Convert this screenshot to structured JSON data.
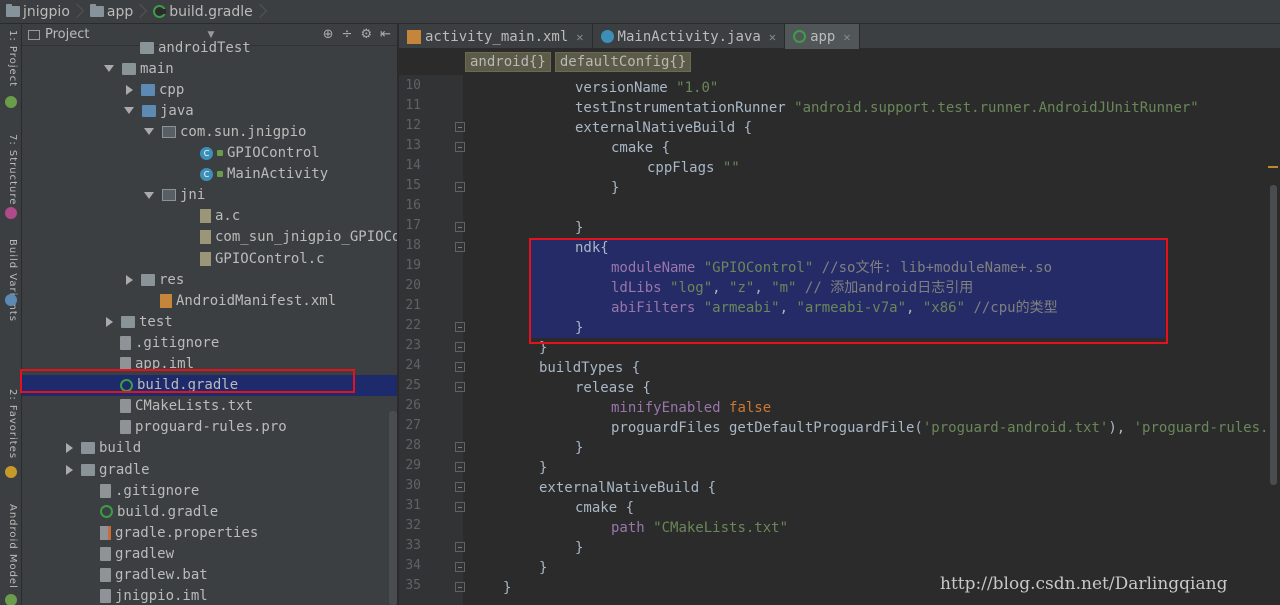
{
  "breadcrumb": [
    {
      "label": "jnigpio",
      "icon": "folder-icon"
    },
    {
      "label": "app",
      "icon": "folder-icon"
    },
    {
      "label": "build.gradle",
      "icon": "gradle-icon"
    }
  ],
  "left_strip": {
    "labels": [
      "1: Project",
      "7: Structure",
      "Build Variants",
      "2: Favorites",
      "Android Model"
    ]
  },
  "project_panel": {
    "title": "Project",
    "tools": [
      "⊕",
      "÷",
      "⚙",
      "⇤"
    ],
    "rows": [
      {
        "label": "androidTest",
        "indent": 4,
        "arrow": "none",
        "icon": "folder"
      },
      {
        "label": "main",
        "indent": 3,
        "arrow": "down",
        "icon": "folder"
      },
      {
        "label": "cpp",
        "indent": 4,
        "arrow": "right",
        "icon": "folder-blue"
      },
      {
        "label": "java",
        "indent": 4,
        "arrow": "down",
        "icon": "folder-blue"
      },
      {
        "label": "com.sun.jnigpio",
        "indent": 5,
        "arrow": "down",
        "icon": "pkg"
      },
      {
        "label": "GPIOControl",
        "indent": 7,
        "arrow": "none",
        "icon": "cls",
        "lock": true
      },
      {
        "label": "MainActivity",
        "indent": 7,
        "arrow": "none",
        "icon": "cls",
        "lock": true
      },
      {
        "label": "jni",
        "indent": 5,
        "arrow": "down",
        "icon": "pkg"
      },
      {
        "label": "a.c",
        "indent": 7,
        "arrow": "none",
        "icon": "cfile"
      },
      {
        "label": "com_sun_jnigpio_GPIOControl",
        "indent": 7,
        "arrow": "none",
        "icon": "cfile"
      },
      {
        "label": "GPIOControl.c",
        "indent": 7,
        "arrow": "none",
        "icon": "cfile"
      },
      {
        "label": "res",
        "indent": 4,
        "arrow": "right",
        "icon": "folder-res"
      },
      {
        "label": "AndroidManifest.xml",
        "indent": 5,
        "arrow": "none",
        "icon": "xml"
      },
      {
        "label": "test",
        "indent": 3,
        "arrow": "right",
        "icon": "folder"
      },
      {
        "label": ".gitignore",
        "indent": 3,
        "arrow": "none",
        "icon": "file"
      },
      {
        "label": "app.iml",
        "indent": 3,
        "arrow": "none",
        "icon": "file"
      },
      {
        "label": "build.gradle",
        "indent": 3,
        "arrow": "none",
        "icon": "gradle",
        "selected": true
      },
      {
        "label": "CMakeLists.txt",
        "indent": 3,
        "arrow": "none",
        "icon": "file"
      },
      {
        "label": "proguard-rules.pro",
        "indent": 3,
        "arrow": "none",
        "icon": "file"
      },
      {
        "label": "build",
        "indent": 1,
        "arrow": "right",
        "icon": "folder"
      },
      {
        "label": "gradle",
        "indent": 1,
        "arrow": "right",
        "icon": "folder"
      },
      {
        "label": ".gitignore",
        "indent": 2,
        "arrow": "none",
        "icon": "file"
      },
      {
        "label": "build.gradle",
        "indent": 2,
        "arrow": "none",
        "icon": "gradle"
      },
      {
        "label": "gradle.properties",
        "indent": 2,
        "arrow": "none",
        "icon": "props"
      },
      {
        "label": "gradlew",
        "indent": 2,
        "arrow": "none",
        "icon": "file"
      },
      {
        "label": "gradlew.bat",
        "indent": 2,
        "arrow": "none",
        "icon": "file"
      },
      {
        "label": "jnigpio.iml",
        "indent": 2,
        "arrow": "none",
        "icon": "file"
      }
    ]
  },
  "editor": {
    "tabs": [
      {
        "label": "activity_main.xml",
        "icon": "xml-file-icon",
        "active": false
      },
      {
        "label": "MainActivity.java",
        "icon": "java-class-icon",
        "active": false
      },
      {
        "label": "app",
        "icon": "gradle-icon",
        "active": true
      }
    ],
    "crumbs": [
      "android{}",
      "defaultConfig{}"
    ],
    "lines": [
      {
        "n": "10",
        "ind": 3,
        "parts": [
          [
            "",
            "versionName "
          ],
          [
            "str",
            "\"1.0\""
          ]
        ]
      },
      {
        "n": "11",
        "ind": 3,
        "parts": [
          [
            "",
            "testInstrumentationRunner "
          ],
          [
            "str",
            "\"android.support.test.runner.AndroidJUnitRunner\""
          ]
        ]
      },
      {
        "n": "12",
        "ind": 3,
        "parts": [
          [
            "",
            "externalNativeBuild {"
          ]
        ],
        "fold": true
      },
      {
        "n": "13",
        "ind": 4,
        "parts": [
          [
            "",
            "cmake {"
          ]
        ],
        "fold": true
      },
      {
        "n": "14",
        "ind": 5,
        "parts": [
          [
            "",
            "cppFlags "
          ],
          [
            "str",
            "\"\""
          ]
        ]
      },
      {
        "n": "15",
        "ind": 4,
        "parts": [
          [
            "",
            "}"
          ]
        ],
        "fold": true
      },
      {
        "n": "16",
        "ind": 0,
        "parts": []
      },
      {
        "n": "17",
        "ind": 3,
        "parts": [
          [
            "",
            "}"
          ]
        ],
        "fold": true
      },
      {
        "n": "18",
        "ind": 3,
        "parts": [
          [
            "",
            "ndk{"
          ]
        ],
        "fold": true
      },
      {
        "n": "19",
        "ind": 4,
        "parts": [
          [
            "prop",
            "moduleName "
          ],
          [
            "str",
            "\"GPIOControl\" "
          ],
          [
            "cmt",
            "//so文件: lib+moduleName+.so"
          ]
        ]
      },
      {
        "n": "20",
        "ind": 4,
        "parts": [
          [
            "prop",
            "ldLibs "
          ],
          [
            "str",
            "\"log\""
          ],
          [
            "",
            ", "
          ],
          [
            "str",
            "\"z\""
          ],
          [
            "",
            ", "
          ],
          [
            "str",
            "\"m\" "
          ],
          [
            "cmt",
            "// 添加android日志引用"
          ]
        ]
      },
      {
        "n": "21",
        "ind": 4,
        "parts": [
          [
            "prop",
            "abiFilters "
          ],
          [
            "str",
            "\"armeabi\""
          ],
          [
            "",
            ", "
          ],
          [
            "str",
            "\"armeabi-v7a\""
          ],
          [
            "",
            ", "
          ],
          [
            "str",
            "\"x86\" "
          ],
          [
            "cmt",
            "//cpu的类型"
          ]
        ]
      },
      {
        "n": "22",
        "ind": 3,
        "parts": [
          [
            "",
            "}"
          ]
        ],
        "fold": true,
        "current": true
      },
      {
        "n": "23",
        "ind": 2,
        "parts": [
          [
            "",
            "}"
          ]
        ],
        "fold": true
      },
      {
        "n": "24",
        "ind": 2,
        "parts": [
          [
            "",
            "buildTypes {"
          ]
        ],
        "fold": true
      },
      {
        "n": "25",
        "ind": 3,
        "parts": [
          [
            "",
            "release {"
          ]
        ],
        "fold": true
      },
      {
        "n": "26",
        "ind": 4,
        "parts": [
          [
            "prop",
            "minifyEnabled "
          ],
          [
            "kw",
            "false"
          ]
        ]
      },
      {
        "n": "27",
        "ind": 4,
        "parts": [
          [
            "",
            "proguardFiles getDefaultProguardFile("
          ],
          [
            "str",
            "'proguard-android.txt'"
          ],
          [
            "",
            "), "
          ],
          [
            "str",
            "'proguard-rules.pro'"
          ]
        ]
      },
      {
        "n": "28",
        "ind": 3,
        "parts": [
          [
            "",
            "}"
          ]
        ],
        "fold": true
      },
      {
        "n": "29",
        "ind": 2,
        "parts": [
          [
            "",
            "}"
          ]
        ],
        "fold": true
      },
      {
        "n": "30",
        "ind": 2,
        "parts": [
          [
            "",
            "externalNativeBuild {"
          ]
        ],
        "fold": true
      },
      {
        "n": "31",
        "ind": 3,
        "parts": [
          [
            "",
            "cmake {"
          ]
        ],
        "fold": true
      },
      {
        "n": "32",
        "ind": 4,
        "parts": [
          [
            "prop",
            "path "
          ],
          [
            "str",
            "\"CMakeLists.txt\""
          ]
        ]
      },
      {
        "n": "33",
        "ind": 3,
        "parts": [
          [
            "",
            "}"
          ]
        ],
        "fold": true
      },
      {
        "n": "34",
        "ind": 2,
        "parts": [
          [
            "",
            "}"
          ]
        ],
        "fold": true
      },
      {
        "n": "35",
        "ind": 1,
        "parts": [
          [
            "",
            "}"
          ]
        ],
        "fold": true
      }
    ]
  },
  "watermark": "http://blog.csdn.net/Darlingqiang"
}
